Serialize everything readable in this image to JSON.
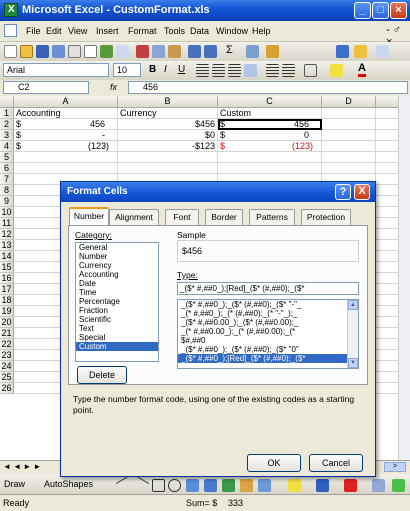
{
  "window": {
    "title": "Microsoft Excel - CustomFormat.xls"
  },
  "menu": {
    "items": [
      "File",
      "Edit",
      "View",
      "Insert",
      "Format",
      "Tools",
      "Data",
      "Window",
      "Help"
    ]
  },
  "toolbar": {
    "font_name": "Arial",
    "font_size": "10",
    "bold": "B",
    "italic": "I",
    "underline": "U",
    "sum": "Σ",
    "font_color": "A"
  },
  "formula_bar": {
    "name_box": "C2",
    "fx": "fx",
    "value": "456"
  },
  "sheet": {
    "columns": [
      "A",
      "B",
      "C",
      "D"
    ],
    "rows": [
      "1",
      "2",
      "3",
      "4",
      "5",
      "6",
      "7",
      "8",
      "9",
      "10",
      "11",
      "12",
      "13",
      "14",
      "15",
      "16",
      "17",
      "18",
      "19",
      "20",
      "21",
      "22",
      "23",
      "24",
      "25",
      "26"
    ],
    "headers": {
      "a": "Accounting",
      "b": "Currency",
      "c": "Custom"
    },
    "data": [
      {
        "a_sym": "$",
        "a_val": "456",
        "b": "$456",
        "c_sym": "$",
        "c_val": "456"
      },
      {
        "a_sym": "$",
        "a_val": "-",
        "b": "$0",
        "c_sym": "$",
        "c_val": "0"
      },
      {
        "a_sym": "$",
        "a_val": "(123)",
        "b": "-$123",
        "c_sym": "$",
        "c_val": "(123)"
      }
    ]
  },
  "dialog": {
    "title": "Format Cells",
    "help": "?",
    "close": "X",
    "tabs": [
      "Number",
      "Alignment",
      "Font",
      "Border",
      "Patterns",
      "Protection"
    ],
    "category_label": "Category:",
    "categories": [
      "General",
      "Number",
      "Currency",
      "Accounting",
      "Date",
      "Time",
      "Percentage",
      "Fraction",
      "Scientific",
      "Text",
      "Special",
      "Custom"
    ],
    "selected_category": "Custom",
    "sample_label": "Sample",
    "sample_value": "$456",
    "type_label": "Type:",
    "type_value": "_($* #,##0_);[Red]_($* (#,##0);_($*",
    "type_list": [
      "_($* #,##0_);_($* (#,##0);_($* \"-\"_",
      "_(* #,##0_);_(* (#,##0);_(* \"-\"_);_",
      "_($* #,##0.00_);_($* (#,##0.00);_",
      "_(* #,##0.00_);_(* (#,##0.00);_(*",
      "$#,##0",
      "_($* #,##0_);_($* (#,##0);_($* \"0\"",
      "_($* #,##0_);[Red]_($* (#,##0);_($*"
    ],
    "delete_label": "Delete",
    "description": "Type the number format code, using one of the existing codes as a starting point.",
    "ok_label": "OK",
    "cancel_label": "Cancel"
  },
  "drawing_toolbar": {
    "draw_label": "Draw",
    "autoshapes_label": "AutoShapes"
  },
  "status": {
    "ready": "Ready",
    "sum": "Sum= $",
    "sum_value": "333"
  }
}
